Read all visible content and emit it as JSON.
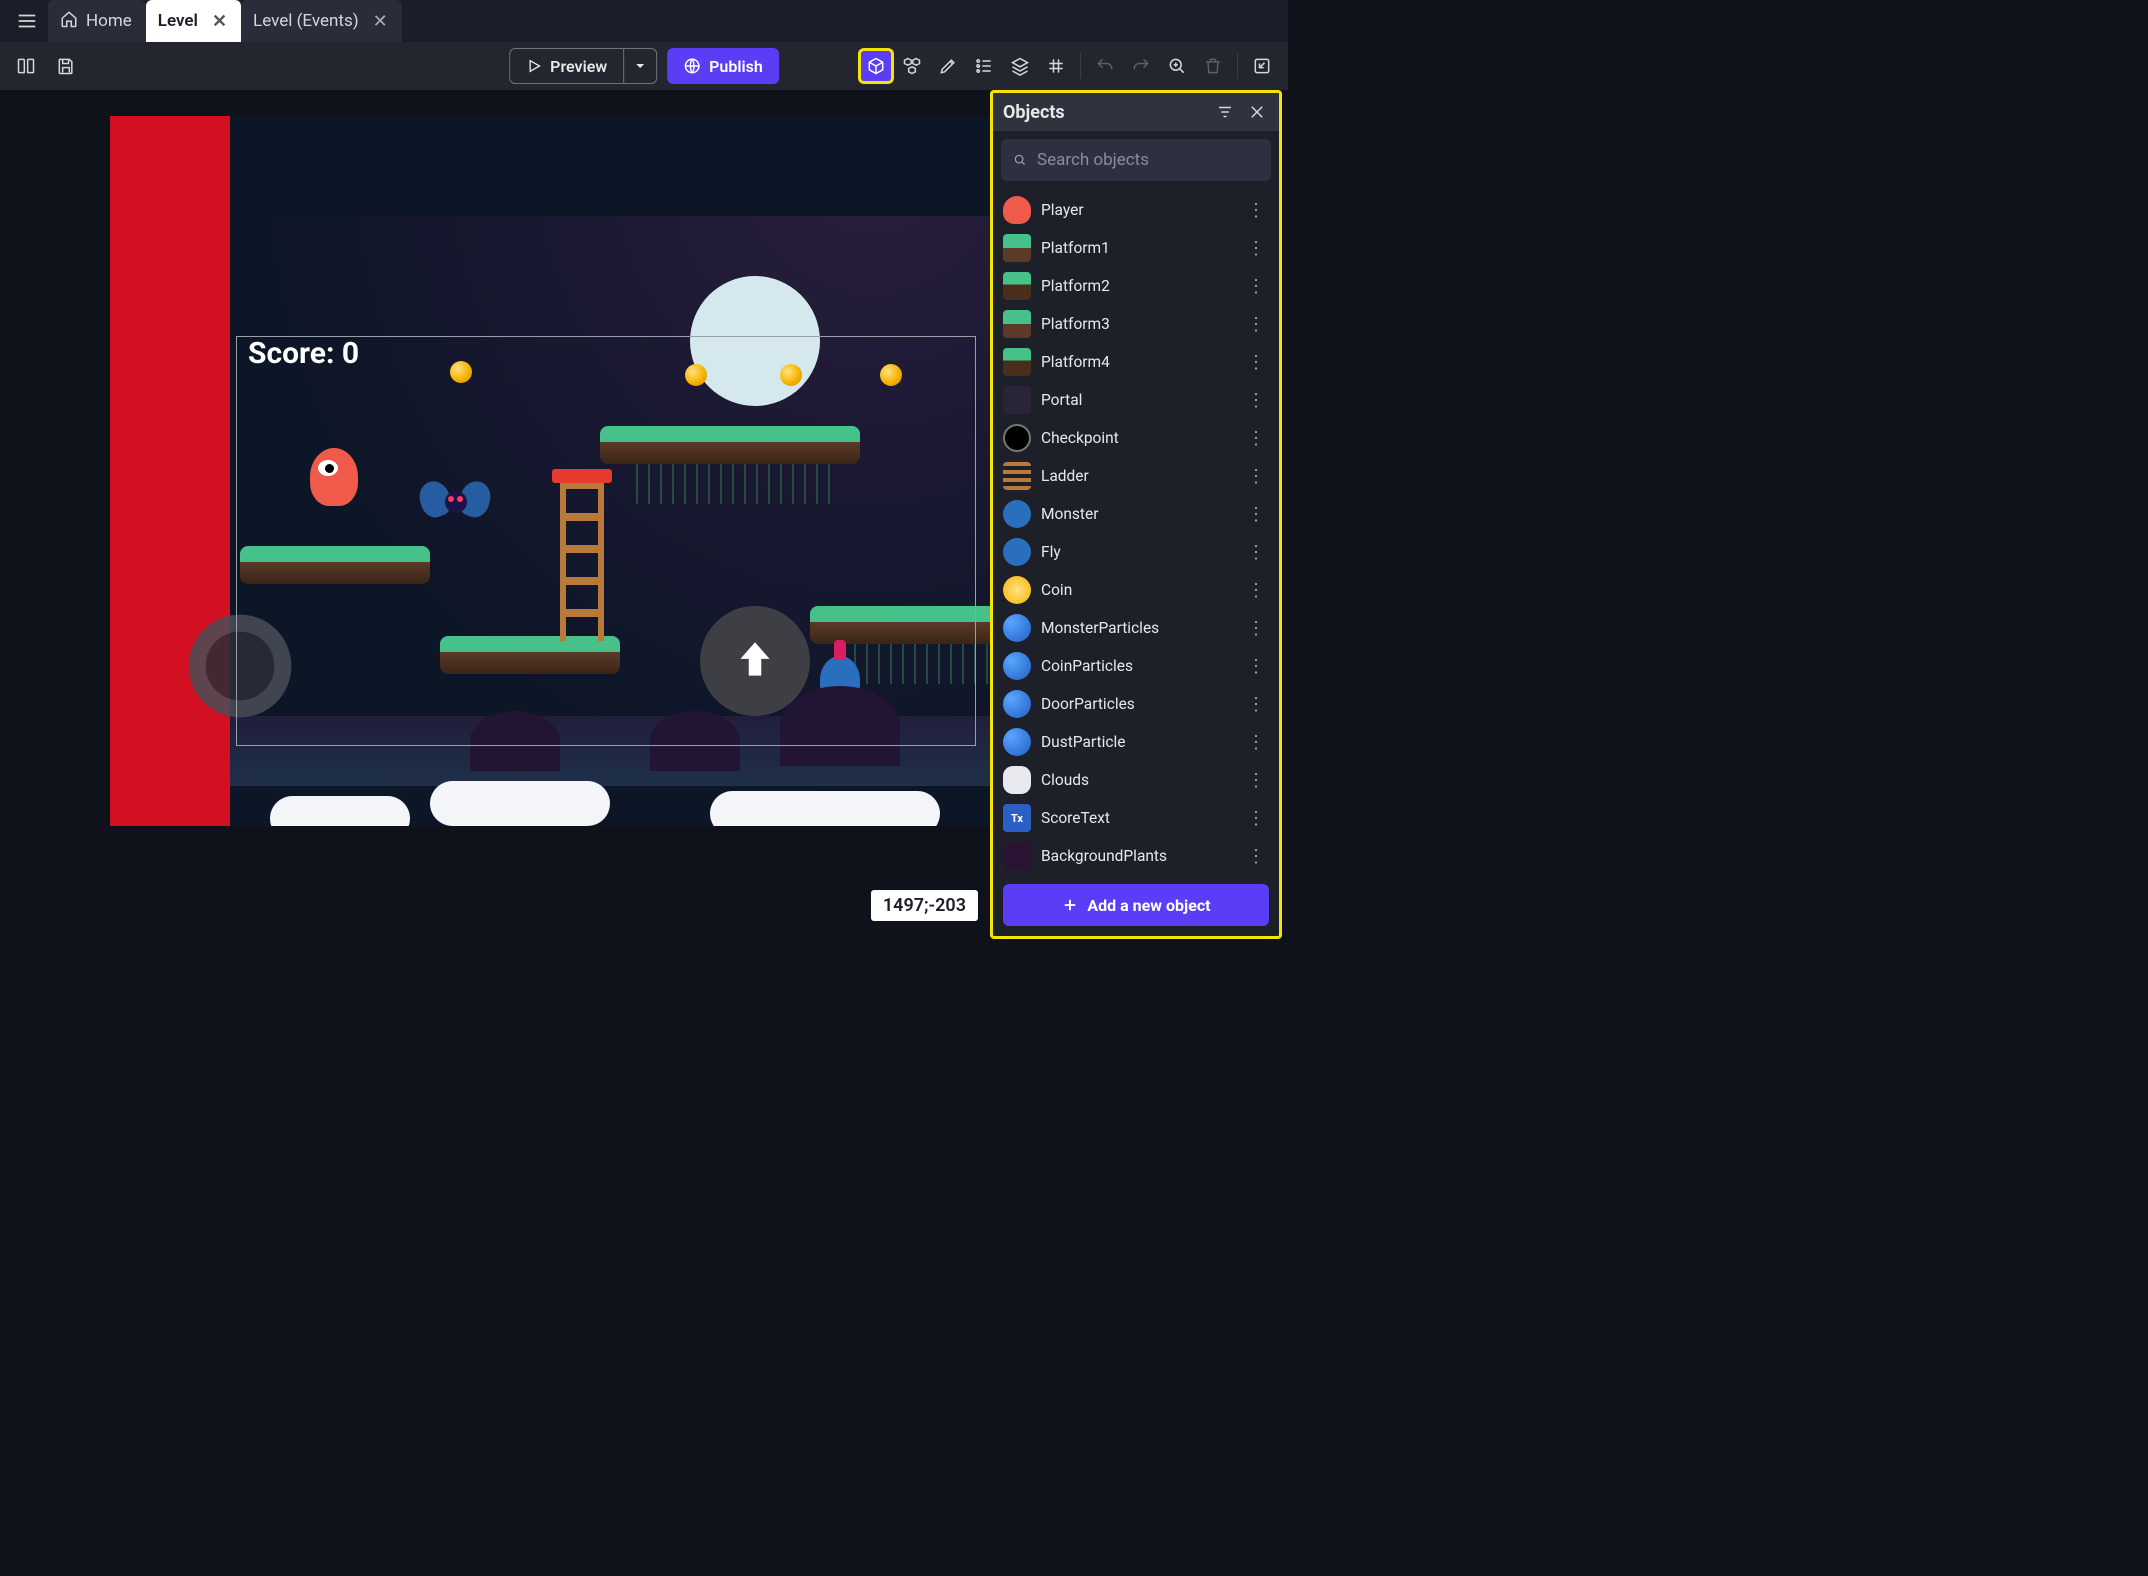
{
  "tabs": {
    "home": "Home",
    "level": "Level",
    "events": "Level (Events)"
  },
  "toolbar": {
    "preview": "Preview",
    "publish": "Publish"
  },
  "scene": {
    "score_label": "Score: 0",
    "coords": "1497;-203"
  },
  "panel": {
    "title": "Objects",
    "search_placeholder": "Search objects",
    "add_label": "Add a new object"
  },
  "objects": [
    {
      "name": "Player",
      "thumb": "th-player"
    },
    {
      "name": "Platform1",
      "thumb": "th-plat"
    },
    {
      "name": "Platform2",
      "thumb": "th-plat2"
    },
    {
      "name": "Platform3",
      "thumb": "th-plat"
    },
    {
      "name": "Platform4",
      "thumb": "th-plat2"
    },
    {
      "name": "Portal",
      "thumb": "th-portal"
    },
    {
      "name": "Checkpoint",
      "thumb": "th-check"
    },
    {
      "name": "Ladder",
      "thumb": "th-ladder"
    },
    {
      "name": "Monster",
      "thumb": "th-monster"
    },
    {
      "name": "Fly",
      "thumb": "th-fly"
    },
    {
      "name": "Coin",
      "thumb": "th-coin"
    },
    {
      "name": "MonsterParticles",
      "thumb": "th-part"
    },
    {
      "name": "CoinParticles",
      "thumb": "th-part"
    },
    {
      "name": "DoorParticles",
      "thumb": "th-part"
    },
    {
      "name": "DustParticle",
      "thumb": "th-part"
    },
    {
      "name": "Clouds",
      "thumb": "th-clouds"
    },
    {
      "name": "ScoreText",
      "thumb": "th-text"
    },
    {
      "name": "BackgroundPlants",
      "thumb": "th-bg"
    }
  ]
}
